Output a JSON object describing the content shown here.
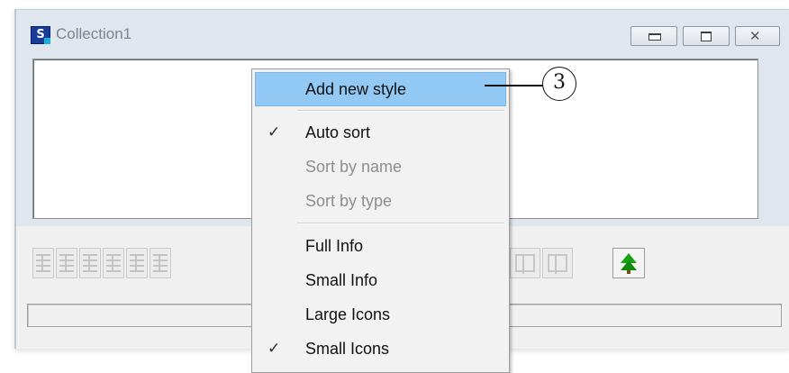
{
  "window": {
    "title": "Collection1",
    "app_icon_letter": "S"
  },
  "toolbar": {
    "buttons": [
      "align-left-icon",
      "align-justify-icon",
      "align-top-icon",
      "align-bottom-icon",
      "distribute-horizontal-icon",
      "distribute-vertical-icon"
    ],
    "frame_buttons": [
      "frame-select-icon",
      "frame-group-icon"
    ],
    "tree_button": "tree-icon"
  },
  "context_menu": {
    "items": [
      {
        "label": "Add new style",
        "state": "highlighted",
        "checked": false
      },
      {
        "label": "Auto sort",
        "state": "enabled",
        "checked": true
      },
      {
        "label": "Sort by name",
        "state": "disabled",
        "checked": false
      },
      {
        "label": "Sort by type",
        "state": "disabled",
        "checked": false
      },
      {
        "label": "Full Info",
        "state": "enabled",
        "checked": false
      },
      {
        "label": "Small Info",
        "state": "enabled",
        "checked": false
      },
      {
        "label": "Large Icons",
        "state": "enabled",
        "checked": false
      },
      {
        "label": "Small Icons",
        "state": "enabled",
        "checked": true
      }
    ],
    "check_glyph": "✓",
    "highlight_color": "#92c9f4"
  },
  "callout": {
    "number": "3"
  }
}
